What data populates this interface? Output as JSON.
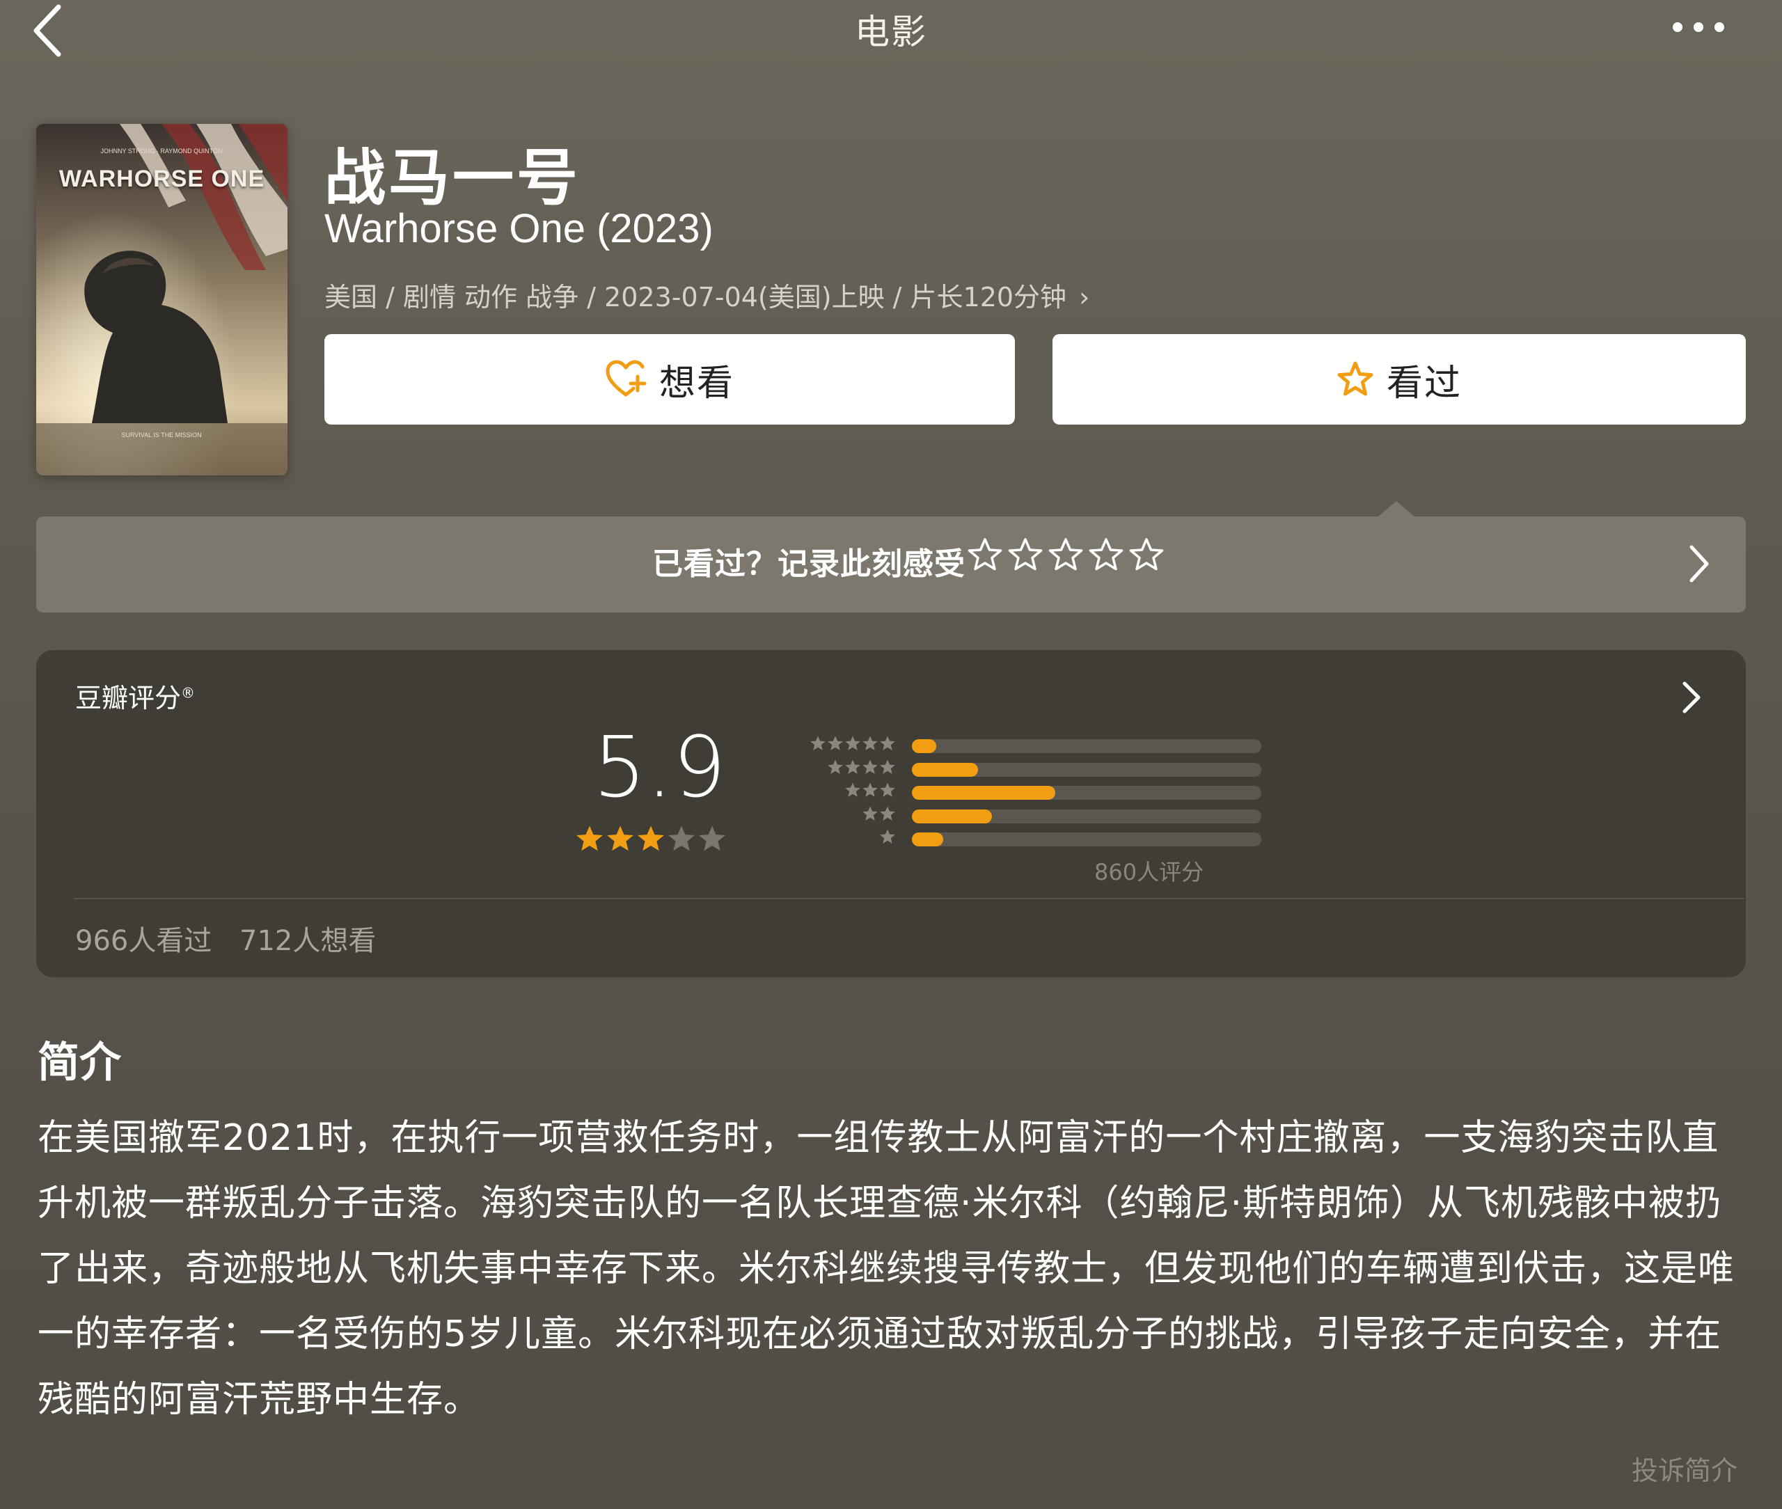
{
  "nav": {
    "title": "电影",
    "back_icon": "chevron-left-icon",
    "more_icon": "more-dots-icon"
  },
  "movie": {
    "poster_title": "WARHORSE ONE",
    "title": "战马一号",
    "subtitle": "Warhorse One (2023)",
    "meta": "美国 / 剧情 动作 战争 / 2023-07-04(美国)上映 / 片长120分钟",
    "meta_chevron": "›"
  },
  "actions": {
    "want_label": "想看",
    "want_icon": "heart-plus-icon",
    "seen_label": "看过",
    "seen_icon": "star-outline-icon"
  },
  "rate_banner": {
    "prompt": "已看过？记录此刻感受",
    "star_count": 5,
    "chevron": "›"
  },
  "rating": {
    "label": "豆瓣评分",
    "label_mark": "®",
    "score": "5.9",
    "score_stars": 3,
    "distribution": [
      {
        "stars": 5,
        "fraction": 0.07
      },
      {
        "stars": 4,
        "fraction": 0.19
      },
      {
        "stars": 3,
        "fraction": 0.41
      },
      {
        "stars": 2,
        "fraction": 0.23
      },
      {
        "stars": 1,
        "fraction": 0.09
      }
    ],
    "rating_count": "860人评分",
    "seen_count": "966人看过",
    "want_count": "712人想看"
  },
  "intro": {
    "heading": "简介",
    "text": "在美国撤军2021时，在执行一项营救任务时，一组传教士从阿富汗的一个村庄撤离，一支海豹突击队直升机被一群叛乱分子击落。海豹突击队的一名队长理查德·米尔科（约翰尼·斯特朗饰）从飞机残骸中被扔了出来，奇迹般地从飞机失事中幸存下来。米尔科继续搜寻传教士，但发现他们的车辆遭到伏击，这是唯一的幸存者：一名受伤的5岁儿童。米尔科现在必须通过敌对叛乱分子的挑战，引导孩子走向安全，并在残酷的阿富汗荒野中生存。",
    "report_link": "投诉简介"
  },
  "colors": {
    "accent": "#f19e12",
    "card_bg": "#403d37",
    "banner_bg": "#7c786e"
  }
}
